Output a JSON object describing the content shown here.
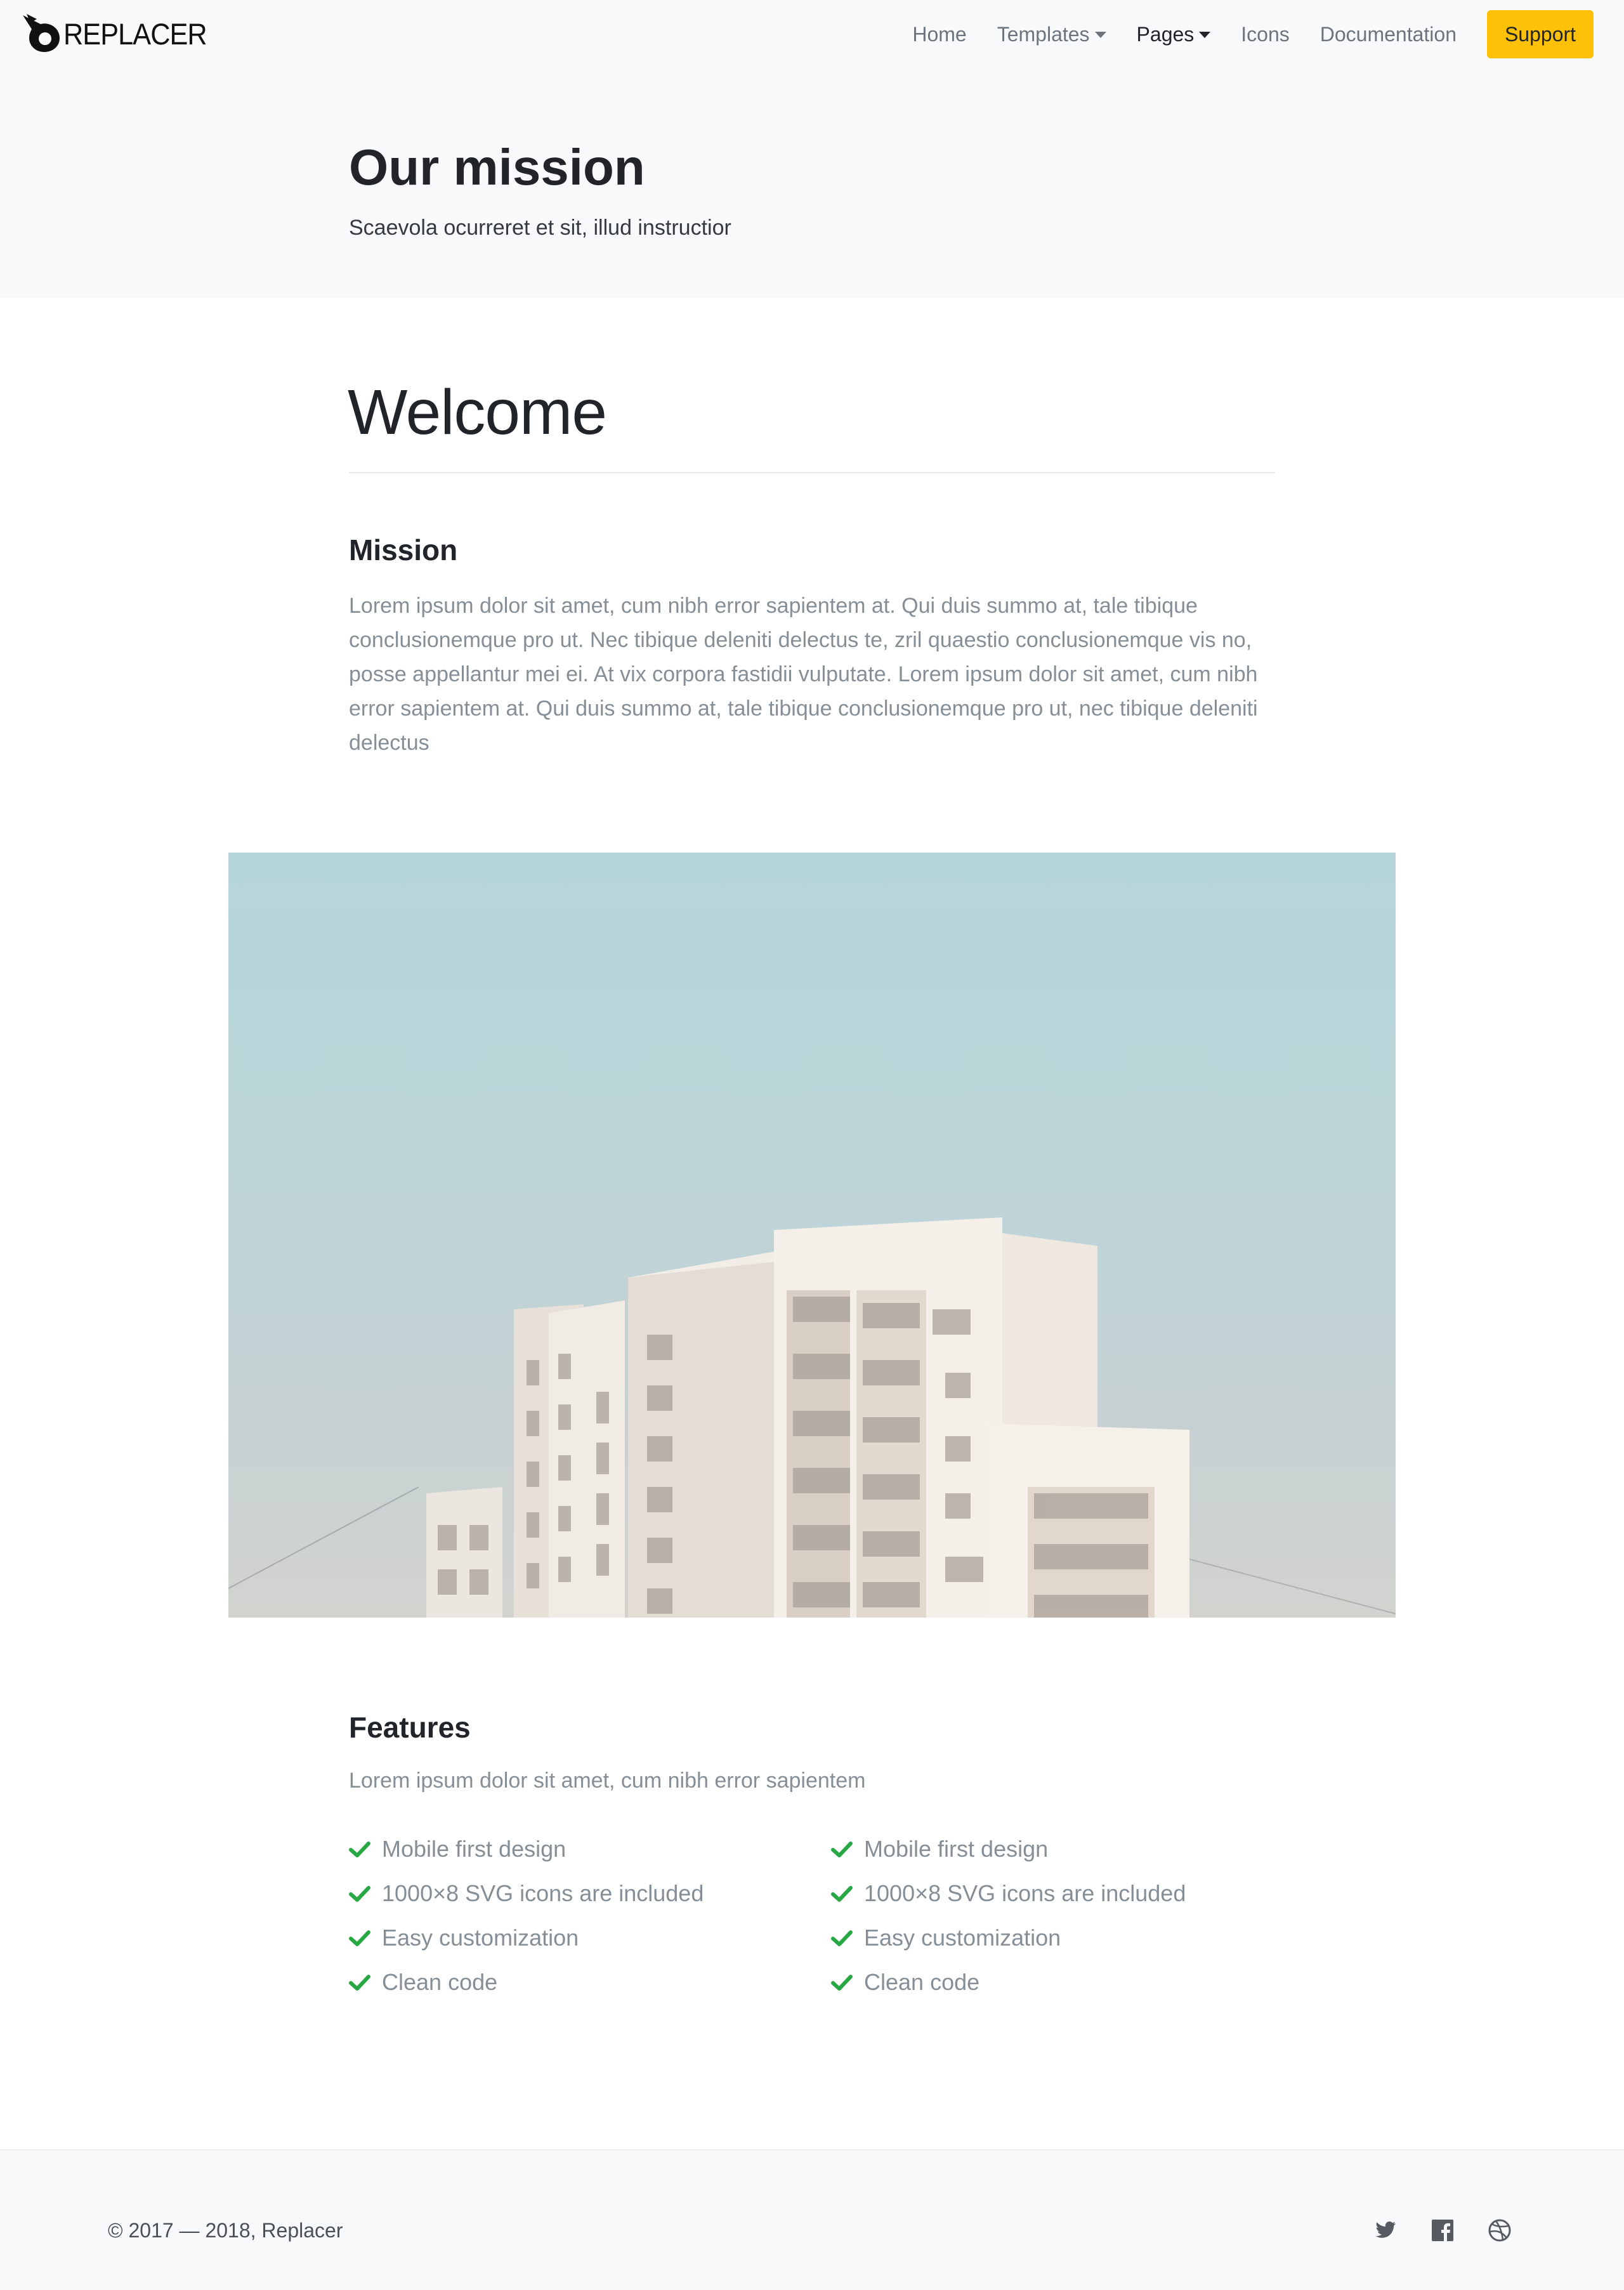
{
  "brand": {
    "name": "REPLACER"
  },
  "nav": {
    "items": [
      {
        "label": "Home",
        "dropdown": false,
        "active": false
      },
      {
        "label": "Templates",
        "dropdown": true,
        "active": false
      },
      {
        "label": "Pages",
        "dropdown": true,
        "active": true
      },
      {
        "label": "Icons",
        "dropdown": false,
        "active": false
      },
      {
        "label": "Documentation",
        "dropdown": false,
        "active": false
      }
    ],
    "support_label": "Support"
  },
  "hero": {
    "title": "Our mission",
    "subtitle": "Scaevola ocurreret et sit, illud instructior"
  },
  "content": {
    "welcome": "Welcome",
    "mission": {
      "heading": "Mission",
      "text": "Lorem ipsum dolor sit amet, cum nibh error sapientem at. Qui duis summo at, tale tibique conclusionemque pro ut. Nec tibique deleniti delectus te, zril quaestio conclusionemque vis no, posse appellantur mei ei. At vix corpora fastidii vulputate. Lorem ipsum dolor sit amet, cum nibh error sapientem at. Qui duis summo at, tale tibique conclusionemque pro ut, nec tibique deleniti delectus"
    },
    "features": {
      "heading": "Features",
      "subtitle": "Lorem ipsum dolor sit amet, cum nibh error sapientem",
      "column1": [
        "Mobile first design",
        "1000×8 SVG icons are included",
        "Easy customization",
        "Clean code"
      ],
      "column2": [
        "Mobile first design",
        "1000×8 SVG icons are included",
        "Easy customization",
        "Clean code"
      ]
    }
  },
  "footer": {
    "copyright": "© 2017 — 2018, Replacer",
    "social": [
      "twitter-icon",
      "facebook-icon",
      "dribbble-icon"
    ]
  },
  "colors": {
    "accent": "#ffc107",
    "check": "#28a745",
    "muted_text": "#868e96",
    "hero_bg": "#f8f9fa"
  }
}
